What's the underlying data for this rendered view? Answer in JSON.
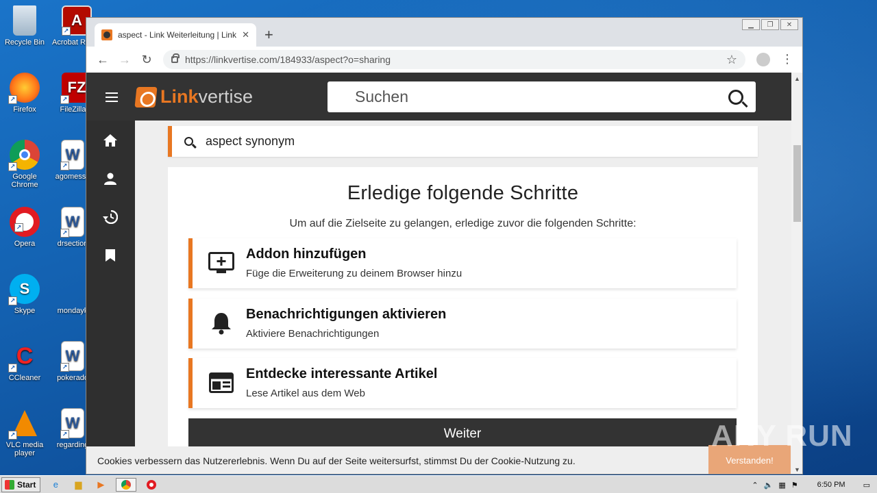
{
  "desktop": {
    "icons": [
      {
        "label": "Recycle Bin"
      },
      {
        "label": "Acrobat Reader"
      },
      {
        "label": "Firefox"
      },
      {
        "label": "FileZilla C"
      },
      {
        "label": "Google Chrome"
      },
      {
        "label": "agomessa"
      },
      {
        "label": "Opera"
      },
      {
        "label": "drsection"
      },
      {
        "label": "Skype"
      },
      {
        "label": "mondayk"
      },
      {
        "label": "CCleaner"
      },
      {
        "label": "pokerado"
      },
      {
        "label": "VLC media player"
      },
      {
        "label": "regarding"
      }
    ]
  },
  "browser": {
    "tab_title": "aspect - Link Weiterleitung | Linkvert",
    "url": "https://linkvertise.com/184933/aspect?o=sharing"
  },
  "site": {
    "logo_part1": "Link",
    "logo_part2": "vertise",
    "search_placeholder": "Suchen",
    "query": "aspect synonym",
    "heading": "Erledige folgende Schritte",
    "subheading": "Um auf die Zielseite zu gelangen, erledige zuvor die folgenden Schritte:",
    "steps": [
      {
        "title": "Addon hinzufügen",
        "desc": "Füge die Erweiterung zu deinem Browser hinzu",
        "icon": "monitor-plus-icon"
      },
      {
        "title": "Benachrichtigungen aktivieren",
        "desc": "Aktiviere Benachrichtigungen",
        "icon": "bell-icon"
      },
      {
        "title": "Entdecke interessante Artikel",
        "desc": "Lese Artikel aus dem Web",
        "icon": "article-icon"
      }
    ],
    "continue_label": "Weiter",
    "cookie_text": "Cookies verbessern das Nutzererlebnis. Wenn Du auf der Seite weitersurfst, stimmst Du der Cookie-Nutzung zu.",
    "cookie_button": "Verstanden!"
  },
  "taskbar": {
    "start_label": "Start",
    "clock": "6:50 PM"
  },
  "watermark": "ANY RUN",
  "colors": {
    "accent": "#e87722",
    "header": "#333333",
    "page_bg": "#eeeeee"
  }
}
